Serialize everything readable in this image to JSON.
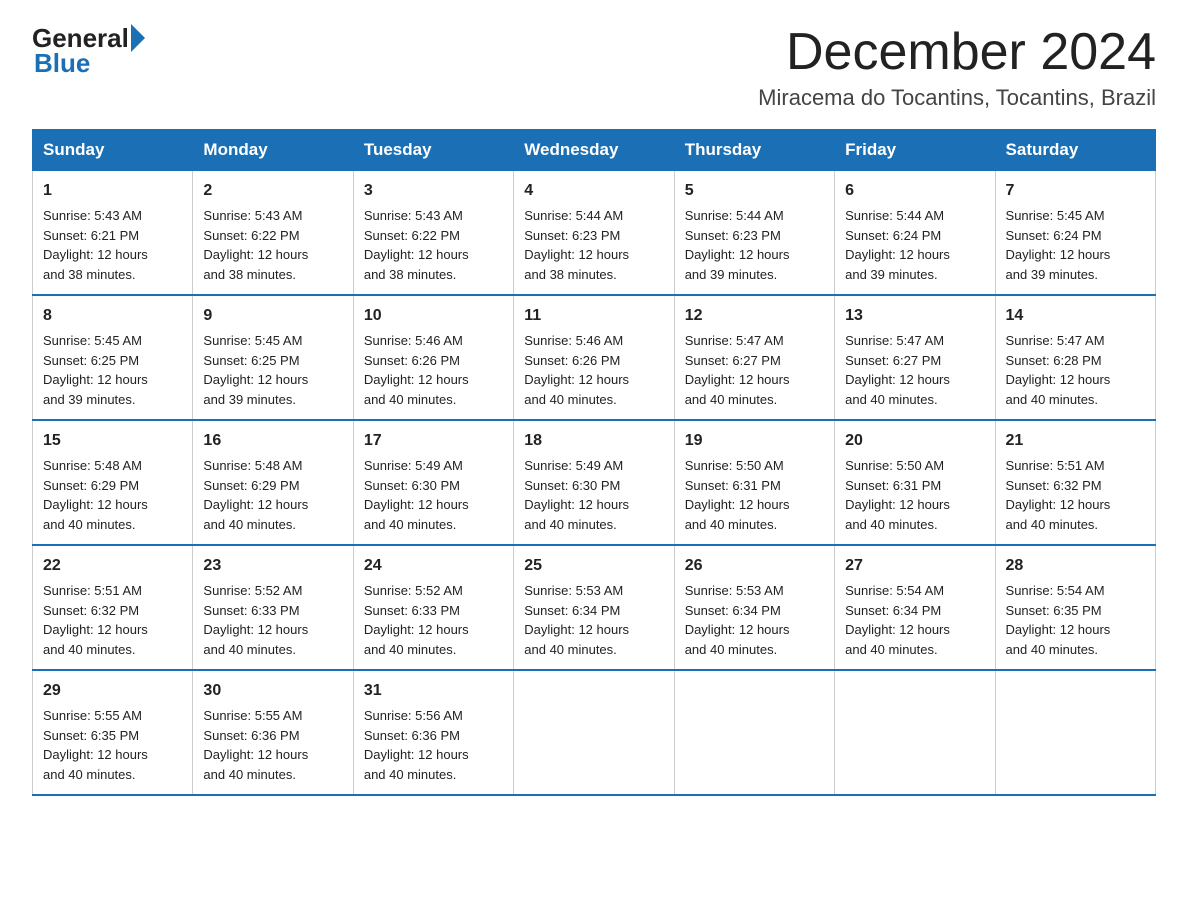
{
  "logo": {
    "general": "General",
    "blue": "Blue"
  },
  "title": "December 2024",
  "subtitle": "Miracema do Tocantins, Tocantins, Brazil",
  "days_of_week": [
    "Sunday",
    "Monday",
    "Tuesday",
    "Wednesday",
    "Thursday",
    "Friday",
    "Saturday"
  ],
  "weeks": [
    [
      {
        "day": "1",
        "sunrise": "5:43 AM",
        "sunset": "6:21 PM",
        "daylight": "12 hours and 38 minutes."
      },
      {
        "day": "2",
        "sunrise": "5:43 AM",
        "sunset": "6:22 PM",
        "daylight": "12 hours and 38 minutes."
      },
      {
        "day": "3",
        "sunrise": "5:43 AM",
        "sunset": "6:22 PM",
        "daylight": "12 hours and 38 minutes."
      },
      {
        "day": "4",
        "sunrise": "5:44 AM",
        "sunset": "6:23 PM",
        "daylight": "12 hours and 38 minutes."
      },
      {
        "day": "5",
        "sunrise": "5:44 AM",
        "sunset": "6:23 PM",
        "daylight": "12 hours and 39 minutes."
      },
      {
        "day": "6",
        "sunrise": "5:44 AM",
        "sunset": "6:24 PM",
        "daylight": "12 hours and 39 minutes."
      },
      {
        "day": "7",
        "sunrise": "5:45 AM",
        "sunset": "6:24 PM",
        "daylight": "12 hours and 39 minutes."
      }
    ],
    [
      {
        "day": "8",
        "sunrise": "5:45 AM",
        "sunset": "6:25 PM",
        "daylight": "12 hours and 39 minutes."
      },
      {
        "day": "9",
        "sunrise": "5:45 AM",
        "sunset": "6:25 PM",
        "daylight": "12 hours and 39 minutes."
      },
      {
        "day": "10",
        "sunrise": "5:46 AM",
        "sunset": "6:26 PM",
        "daylight": "12 hours and 40 minutes."
      },
      {
        "day": "11",
        "sunrise": "5:46 AM",
        "sunset": "6:26 PM",
        "daylight": "12 hours and 40 minutes."
      },
      {
        "day": "12",
        "sunrise": "5:47 AM",
        "sunset": "6:27 PM",
        "daylight": "12 hours and 40 minutes."
      },
      {
        "day": "13",
        "sunrise": "5:47 AM",
        "sunset": "6:27 PM",
        "daylight": "12 hours and 40 minutes."
      },
      {
        "day": "14",
        "sunrise": "5:47 AM",
        "sunset": "6:28 PM",
        "daylight": "12 hours and 40 minutes."
      }
    ],
    [
      {
        "day": "15",
        "sunrise": "5:48 AM",
        "sunset": "6:29 PM",
        "daylight": "12 hours and 40 minutes."
      },
      {
        "day": "16",
        "sunrise": "5:48 AM",
        "sunset": "6:29 PM",
        "daylight": "12 hours and 40 minutes."
      },
      {
        "day": "17",
        "sunrise": "5:49 AM",
        "sunset": "6:30 PM",
        "daylight": "12 hours and 40 minutes."
      },
      {
        "day": "18",
        "sunrise": "5:49 AM",
        "sunset": "6:30 PM",
        "daylight": "12 hours and 40 minutes."
      },
      {
        "day": "19",
        "sunrise": "5:50 AM",
        "sunset": "6:31 PM",
        "daylight": "12 hours and 40 minutes."
      },
      {
        "day": "20",
        "sunrise": "5:50 AM",
        "sunset": "6:31 PM",
        "daylight": "12 hours and 40 minutes."
      },
      {
        "day": "21",
        "sunrise": "5:51 AM",
        "sunset": "6:32 PM",
        "daylight": "12 hours and 40 minutes."
      }
    ],
    [
      {
        "day": "22",
        "sunrise": "5:51 AM",
        "sunset": "6:32 PM",
        "daylight": "12 hours and 40 minutes."
      },
      {
        "day": "23",
        "sunrise": "5:52 AM",
        "sunset": "6:33 PM",
        "daylight": "12 hours and 40 minutes."
      },
      {
        "day": "24",
        "sunrise": "5:52 AM",
        "sunset": "6:33 PM",
        "daylight": "12 hours and 40 minutes."
      },
      {
        "day": "25",
        "sunrise": "5:53 AM",
        "sunset": "6:34 PM",
        "daylight": "12 hours and 40 minutes."
      },
      {
        "day": "26",
        "sunrise": "5:53 AM",
        "sunset": "6:34 PM",
        "daylight": "12 hours and 40 minutes."
      },
      {
        "day": "27",
        "sunrise": "5:54 AM",
        "sunset": "6:34 PM",
        "daylight": "12 hours and 40 minutes."
      },
      {
        "day": "28",
        "sunrise": "5:54 AM",
        "sunset": "6:35 PM",
        "daylight": "12 hours and 40 minutes."
      }
    ],
    [
      {
        "day": "29",
        "sunrise": "5:55 AM",
        "sunset": "6:35 PM",
        "daylight": "12 hours and 40 minutes."
      },
      {
        "day": "30",
        "sunrise": "5:55 AM",
        "sunset": "6:36 PM",
        "daylight": "12 hours and 40 minutes."
      },
      {
        "day": "31",
        "sunrise": "5:56 AM",
        "sunset": "6:36 PM",
        "daylight": "12 hours and 40 minutes."
      },
      null,
      null,
      null,
      null
    ]
  ],
  "labels": {
    "sunrise": "Sunrise:",
    "sunset": "Sunset:",
    "daylight": "Daylight:"
  }
}
